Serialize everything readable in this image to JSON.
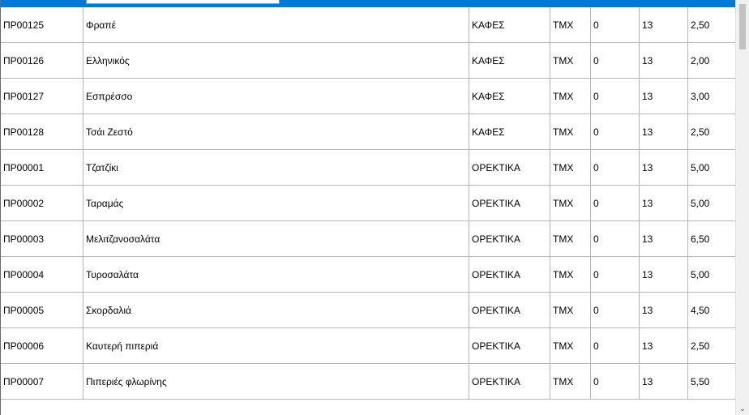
{
  "grid": {
    "rows": [
      [
        "ΠΡ00125",
        "Φραπέ",
        "ΚΑΦΕΣ",
        "ΤΜΧ",
        "0",
        "13",
        "2,50"
      ],
      [
        "ΠΡ00126",
        "Ελληνικός",
        "ΚΑΦΕΣ",
        "ΤΜΧ",
        "0",
        "13",
        "2,00"
      ],
      [
        "ΠΡ00127",
        "Εσπρέσσο",
        "ΚΑΦΕΣ",
        "ΤΜΧ",
        "0",
        "13",
        "3,00"
      ],
      [
        "ΠΡ00128",
        "Τσάι Ζεστό",
        "ΚΑΦΕΣ",
        "ΤΜΧ",
        "0",
        "13",
        "2,50"
      ],
      [
        "ΠΡ00001",
        "Τζατζίκι",
        "ΟΡΕΚΤΙΚΑ",
        "ΤΜΧ",
        "0",
        "13",
        "5,00"
      ],
      [
        "ΠΡ00002",
        "Ταραμάς",
        "ΟΡΕΚΤΙΚΑ",
        "ΤΜΧ",
        "0",
        "13",
        "5,00"
      ],
      [
        "ΠΡ00003",
        "Μελιτζανοσαλάτα",
        "ΟΡΕΚΤΙΚΑ",
        "ΤΜΧ",
        "0",
        "13",
        "6,50"
      ],
      [
        "ΠΡ00004",
        "Τυροσαλάτα",
        "ΟΡΕΚΤΙΚΑ",
        "ΤΜΧ",
        "0",
        "13",
        "5,00"
      ],
      [
        "ΠΡ00005",
        "Σκορδαλιά",
        "ΟΡΕΚΤΙΚΑ",
        "ΤΜΧ",
        "0",
        "13",
        "4,50"
      ],
      [
        "ΠΡ00006",
        "Καυτερή πιπεριά",
        "ΟΡΕΚΤΙΚΑ",
        "ΤΜΧ",
        "0",
        "13",
        "2,50"
      ],
      [
        "ΠΡ00007",
        "Πιπεριές φλωρίνης",
        "ΟΡΕΚΤΙΚΑ",
        "ΤΜΧ",
        "0",
        "13",
        "5,50"
      ]
    ]
  },
  "colors": {
    "selection": "#0078d7",
    "gridline": "#b5b5b5"
  },
  "icons": {
    "scroll_down": "chevron-down-icon"
  }
}
